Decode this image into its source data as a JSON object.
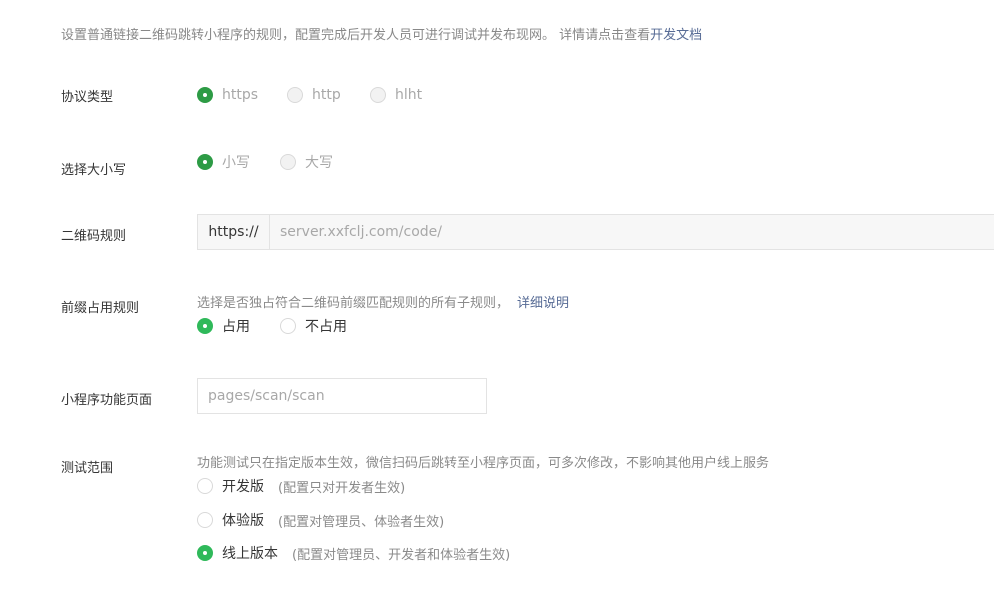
{
  "intro": {
    "text": "设置普通链接二维码跳转小程序的规则，配置完成后开发人员可进行调试并发布现网。 详情请点击查看",
    "link": "开发文档"
  },
  "protocol": {
    "label": "协议类型",
    "options": [
      "https",
      "http",
      "hlht"
    ],
    "selected": "https"
  },
  "case": {
    "label": "选择大小写",
    "options": [
      "小写",
      "大写"
    ],
    "selected": "小写"
  },
  "qr_rule": {
    "label": "二维码规则",
    "prefix": "https://",
    "value": "server.xxfclj.com/code/"
  },
  "prefix_rule": {
    "label": "前缀占用规则",
    "description": "选择是否独占符合二维码前缀匹配规则的所有子规则，",
    "link": "详细说明",
    "options": [
      "占用",
      "不占用"
    ],
    "selected": "占用"
  },
  "page": {
    "label": "小程序功能页面",
    "placeholder": "pages/scan/scan"
  },
  "test_scope": {
    "label": "测试范围",
    "description": "功能测试只在指定版本生效，微信扫码后跳转至小程序页面，可多次修改，不影响其他用户线上服务",
    "options": [
      {
        "label": "开发版",
        "hint": "(配置只对开发者生效)"
      },
      {
        "label": "体验版",
        "hint": "(配置对管理员、体验者生效)"
      },
      {
        "label": "线上版本",
        "hint": "(配置对管理员、开发者和体验者生效)"
      }
    ],
    "selected": "线上版本"
  },
  "colors": {
    "accent": "#2fb95a",
    "accent_disabled": "#2d9b45",
    "link": "#576b95",
    "muted": "#8a8a8a"
  }
}
